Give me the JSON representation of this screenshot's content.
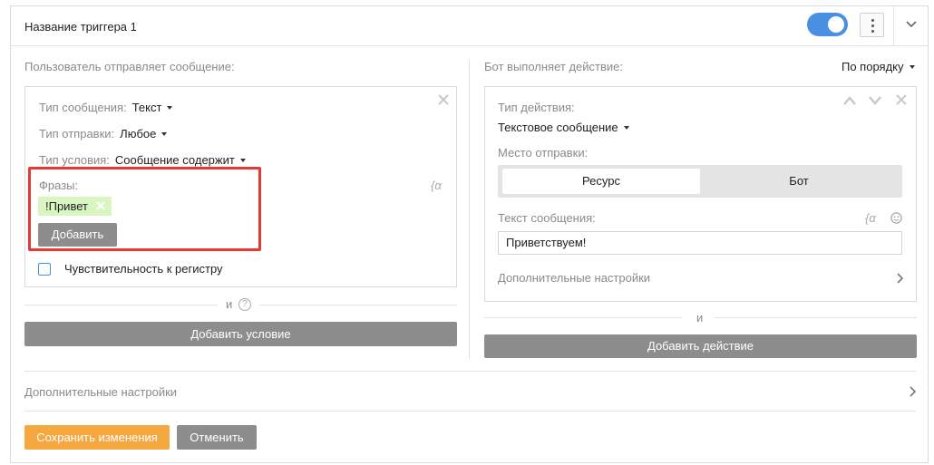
{
  "header": {
    "title": "Название триггера 1",
    "enabled": true
  },
  "condition": {
    "section_label": "Пользователь отправляет сообщение:",
    "message_type_label": "Тип сообщения:",
    "message_type_value": "Текст",
    "send_type_label": "Тип отправки:",
    "send_type_value": "Любое",
    "condition_type_label": "Тип условия:",
    "condition_type_value": "Сообщение содержит",
    "phrases_label": "Фразы:",
    "phrases": [
      "!Привет"
    ],
    "add_phrase_label": "Добавить",
    "case_sensitive_label": "Чувствительность к регистру",
    "case_sensitive_checked": false,
    "and_label": "и",
    "help_glyph": "?",
    "variable_glyph": "{α",
    "add_condition_label": "Добавить условие"
  },
  "action": {
    "section_label": "Бот выполняет действие:",
    "order_value": "По порядку",
    "action_type_label": "Тип действия:",
    "action_type_value": "Текстовое сообщение",
    "send_place_label": "Место отправки:",
    "send_place_options": [
      "Ресурс",
      "Бот"
    ],
    "send_place_selected": "Ресурс",
    "message_text_label": "Текст сообщения:",
    "message_text_value": "Приветствуем!",
    "variable_glyph": "{α",
    "extra_settings_label": "Дополнительные настройки",
    "and_label": "и",
    "add_action_label": "Добавить действие"
  },
  "footer": {
    "extra_settings_label": "Дополнительные настройки",
    "save_label": "Сохранить изменения",
    "cancel_label": "Отменить"
  },
  "colors": {
    "toggle_on": "#4a90e2",
    "highlight": "#e53935",
    "save_button": "#f5a83f",
    "gray_button": "#8d8d8d",
    "tag_bg": "#d8f5c2"
  }
}
